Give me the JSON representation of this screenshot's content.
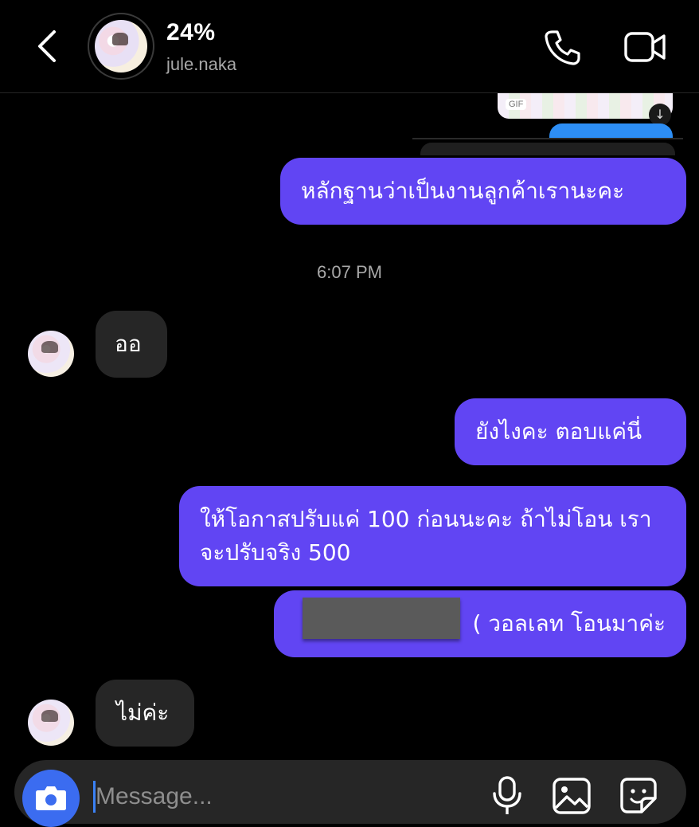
{
  "header": {
    "title": "24%",
    "username": "jule.naka"
  },
  "chat": {
    "gif_tag": "GIF",
    "timestamp": "6:07 PM",
    "messages": [
      {
        "from": "me",
        "text": "หลักฐานว่าเป็นงานลูกค้าเรานะคะ"
      },
      {
        "from": "them",
        "text": "ออ"
      },
      {
        "from": "me",
        "text": "ยังไงคะ ตอบแค่นี่"
      },
      {
        "from": "me",
        "text": "ให้โอกาสปรับแค่ 100 ก่อนนะคะ ถ้าไม่โอน เราจะปรับจริง 500"
      },
      {
        "from": "me",
        "text": "( วอลเลท โอนมาค่ะ"
      },
      {
        "from": "them",
        "text": "ไม่ค่ะ"
      }
    ]
  },
  "composer": {
    "placeholder": "Message..."
  },
  "colors": {
    "outgoing_bubble": "#6145f3",
    "incoming_bubble": "#262626",
    "camera_button": "#3b6cf0",
    "background": "#000000"
  },
  "icons": [
    "back-icon",
    "phone-icon",
    "video-icon",
    "camera-icon",
    "mic-icon",
    "gallery-icon",
    "sticker-icon",
    "download-icon"
  ]
}
